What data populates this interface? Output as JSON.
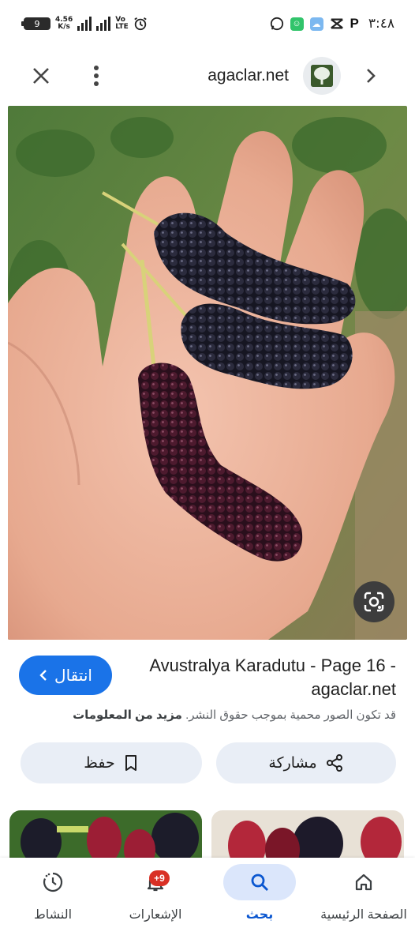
{
  "status_bar": {
    "battery": "9",
    "net_speed_value": "4.56",
    "net_speed_unit": "K/s",
    "volte_line1": "Vo",
    "volte_line2": "LTE",
    "clock": "٣:٤٨",
    "icons": [
      "whatsapp-icon",
      "chat-app-icon",
      "weather-icon",
      "capcut-icon",
      "p-app-icon"
    ]
  },
  "header": {
    "site_name": "agaclar.net"
  },
  "result": {
    "title": "Avustralya Karadutu - Page 16 - agaclar.net",
    "visit_label": "انتقال",
    "copyright_text": "قد تكون الصور محمية بموجب حقوق النشر.",
    "more_info_label": "مزيد من المعلومات",
    "share_label": "مشاركة",
    "save_label": "حفظ"
  },
  "bottom_nav": {
    "items": [
      {
        "label": "الصفحة الرئيسية",
        "icon": "home-icon"
      },
      {
        "label": "بحث",
        "icon": "search-icon",
        "active": true
      },
      {
        "label": "الإشعارات",
        "icon": "bell-icon",
        "badge": "+9"
      },
      {
        "label": "النشاط",
        "icon": "activity-icon"
      }
    ]
  },
  "colors": {
    "accent": "#1a73e8",
    "nav_active": "#0b57d0",
    "button_bg": "#e9eef6",
    "badge": "#d93025"
  }
}
